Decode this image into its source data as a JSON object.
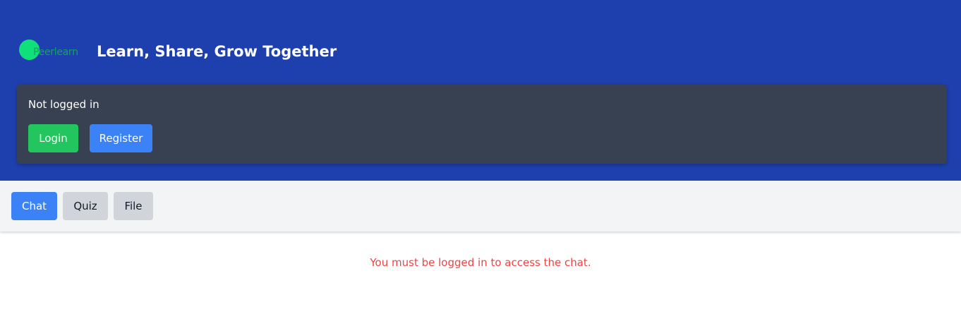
{
  "header": {
    "logo_text": "Peerlearn",
    "title": "Learn, Share, Grow Together",
    "bg_color": "#1e40af"
  },
  "auth": {
    "status": "Not logged in",
    "login_label": "Login",
    "register_label": "Register"
  },
  "tabs": [
    {
      "label": "Chat",
      "active": true
    },
    {
      "label": "Quiz",
      "active": false
    },
    {
      "label": "File",
      "active": false
    }
  ],
  "main": {
    "message": "You must be logged in to access the chat."
  },
  "colors": {
    "accent": "#3b82f6",
    "success": "#22c55e",
    "error": "#ef4444",
    "panel": "#374151",
    "logo": "#10e07a"
  }
}
